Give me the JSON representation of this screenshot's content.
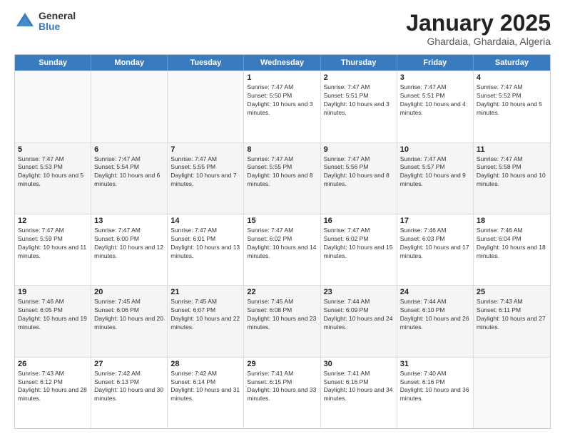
{
  "logo": {
    "general": "General",
    "blue": "Blue"
  },
  "header": {
    "month": "January 2025",
    "location": "Ghardaia, Ghardaia, Algeria"
  },
  "days": [
    "Sunday",
    "Monday",
    "Tuesday",
    "Wednesday",
    "Thursday",
    "Friday",
    "Saturday"
  ],
  "rows": [
    [
      {
        "day": "",
        "empty": true
      },
      {
        "day": "",
        "empty": true
      },
      {
        "day": "",
        "empty": true
      },
      {
        "day": "1",
        "sunrise": "7:47 AM",
        "sunset": "5:50 PM",
        "daylight": "10 hours and 3 minutes."
      },
      {
        "day": "2",
        "sunrise": "7:47 AM",
        "sunset": "5:51 PM",
        "daylight": "10 hours and 3 minutes."
      },
      {
        "day": "3",
        "sunrise": "7:47 AM",
        "sunset": "5:51 PM",
        "daylight": "10 hours and 4 minutes."
      },
      {
        "day": "4",
        "sunrise": "7:47 AM",
        "sunset": "5:52 PM",
        "daylight": "10 hours and 5 minutes."
      }
    ],
    [
      {
        "day": "5",
        "sunrise": "7:47 AM",
        "sunset": "5:53 PM",
        "daylight": "10 hours and 5 minutes."
      },
      {
        "day": "6",
        "sunrise": "7:47 AM",
        "sunset": "5:54 PM",
        "daylight": "10 hours and 6 minutes."
      },
      {
        "day": "7",
        "sunrise": "7:47 AM",
        "sunset": "5:55 PM",
        "daylight": "10 hours and 7 minutes."
      },
      {
        "day": "8",
        "sunrise": "7:47 AM",
        "sunset": "5:55 PM",
        "daylight": "10 hours and 8 minutes."
      },
      {
        "day": "9",
        "sunrise": "7:47 AM",
        "sunset": "5:56 PM",
        "daylight": "10 hours and 8 minutes."
      },
      {
        "day": "10",
        "sunrise": "7:47 AM",
        "sunset": "5:57 PM",
        "daylight": "10 hours and 9 minutes."
      },
      {
        "day": "11",
        "sunrise": "7:47 AM",
        "sunset": "5:58 PM",
        "daylight": "10 hours and 10 minutes."
      }
    ],
    [
      {
        "day": "12",
        "sunrise": "7:47 AM",
        "sunset": "5:59 PM",
        "daylight": "10 hours and 11 minutes."
      },
      {
        "day": "13",
        "sunrise": "7:47 AM",
        "sunset": "6:00 PM",
        "daylight": "10 hours and 12 minutes."
      },
      {
        "day": "14",
        "sunrise": "7:47 AM",
        "sunset": "6:01 PM",
        "daylight": "10 hours and 13 minutes."
      },
      {
        "day": "15",
        "sunrise": "7:47 AM",
        "sunset": "6:02 PM",
        "daylight": "10 hours and 14 minutes."
      },
      {
        "day": "16",
        "sunrise": "7:47 AM",
        "sunset": "6:02 PM",
        "daylight": "10 hours and 15 minutes."
      },
      {
        "day": "17",
        "sunrise": "7:46 AM",
        "sunset": "6:03 PM",
        "daylight": "10 hours and 17 minutes."
      },
      {
        "day": "18",
        "sunrise": "7:46 AM",
        "sunset": "6:04 PM",
        "daylight": "10 hours and 18 minutes."
      }
    ],
    [
      {
        "day": "19",
        "sunrise": "7:46 AM",
        "sunset": "6:05 PM",
        "daylight": "10 hours and 19 minutes."
      },
      {
        "day": "20",
        "sunrise": "7:45 AM",
        "sunset": "6:06 PM",
        "daylight": "10 hours and 20 minutes."
      },
      {
        "day": "21",
        "sunrise": "7:45 AM",
        "sunset": "6:07 PM",
        "daylight": "10 hours and 22 minutes."
      },
      {
        "day": "22",
        "sunrise": "7:45 AM",
        "sunset": "6:08 PM",
        "daylight": "10 hours and 23 minutes."
      },
      {
        "day": "23",
        "sunrise": "7:44 AM",
        "sunset": "6:09 PM",
        "daylight": "10 hours and 24 minutes."
      },
      {
        "day": "24",
        "sunrise": "7:44 AM",
        "sunset": "6:10 PM",
        "daylight": "10 hours and 26 minutes."
      },
      {
        "day": "25",
        "sunrise": "7:43 AM",
        "sunset": "6:11 PM",
        "daylight": "10 hours and 27 minutes."
      }
    ],
    [
      {
        "day": "26",
        "sunrise": "7:43 AM",
        "sunset": "6:12 PM",
        "daylight": "10 hours and 28 minutes."
      },
      {
        "day": "27",
        "sunrise": "7:42 AM",
        "sunset": "6:13 PM",
        "daylight": "10 hours and 30 minutes."
      },
      {
        "day": "28",
        "sunrise": "7:42 AM",
        "sunset": "6:14 PM",
        "daylight": "10 hours and 31 minutes."
      },
      {
        "day": "29",
        "sunrise": "7:41 AM",
        "sunset": "6:15 PM",
        "daylight": "10 hours and 33 minutes."
      },
      {
        "day": "30",
        "sunrise": "7:41 AM",
        "sunset": "6:16 PM",
        "daylight": "10 hours and 34 minutes."
      },
      {
        "day": "31",
        "sunrise": "7:40 AM",
        "sunset": "6:16 PM",
        "daylight": "10 hours and 36 minutes."
      },
      {
        "day": "",
        "empty": true
      }
    ]
  ]
}
